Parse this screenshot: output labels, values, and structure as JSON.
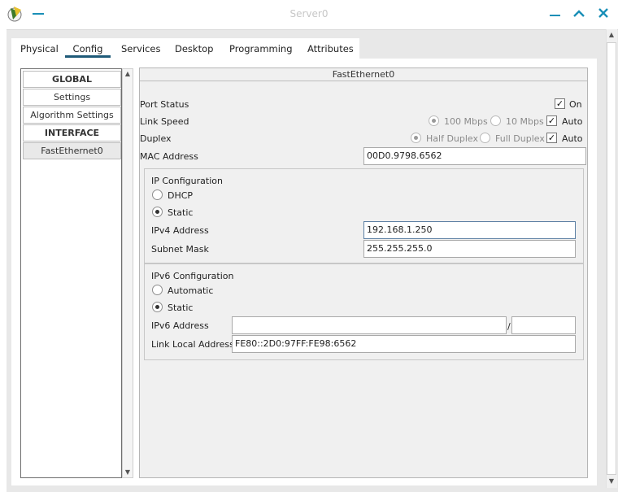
{
  "window": {
    "title": "Server0"
  },
  "tabs": [
    {
      "label": "Physical"
    },
    {
      "label": "Config"
    },
    {
      "label": "Services"
    },
    {
      "label": "Desktop"
    },
    {
      "label": "Programming"
    },
    {
      "label": "Attributes"
    }
  ],
  "active_tab": "Config",
  "sidebar": {
    "items": [
      {
        "label": "GLOBAL"
      },
      {
        "label": "Settings"
      },
      {
        "label": "Algorithm Settings"
      },
      {
        "label": "INTERFACE"
      },
      {
        "label": "FastEthernet0"
      }
    ]
  },
  "panel": {
    "title": "FastEthernet0",
    "port_status": {
      "label": "Port Status",
      "on_label": "On",
      "checked": true
    },
    "link_speed": {
      "label": "Link Speed",
      "opt1": "100 Mbps",
      "opt2": "10 Mbps",
      "auto_label": "Auto"
    },
    "duplex": {
      "label": "Duplex",
      "opt1": "Half Duplex",
      "opt2": "Full Duplex",
      "auto_label": "Auto"
    },
    "mac": {
      "label": "MAC Address",
      "value": "00D0.9798.6562"
    },
    "ipv4": {
      "title": "IP Configuration",
      "dhcp_label": "DHCP",
      "static_label": "Static",
      "address_label": "IPv4 Address",
      "address_value": "192.168.1.250",
      "mask_label": "Subnet Mask",
      "mask_value": "255.255.255.0"
    },
    "ipv6": {
      "title": "IPv6 Configuration",
      "auto_label": "Automatic",
      "static_label": "Static",
      "address_label": "IPv6 Address",
      "address_value": "",
      "slash": "/",
      "prefix_value": "",
      "link_local_label": "Link Local Address:",
      "link_local_value": "FE80::2D0:97FF:FE98:6562"
    }
  },
  "colors": {
    "accent": "#1a8fb7",
    "tab_underline": "#1f5a78"
  }
}
